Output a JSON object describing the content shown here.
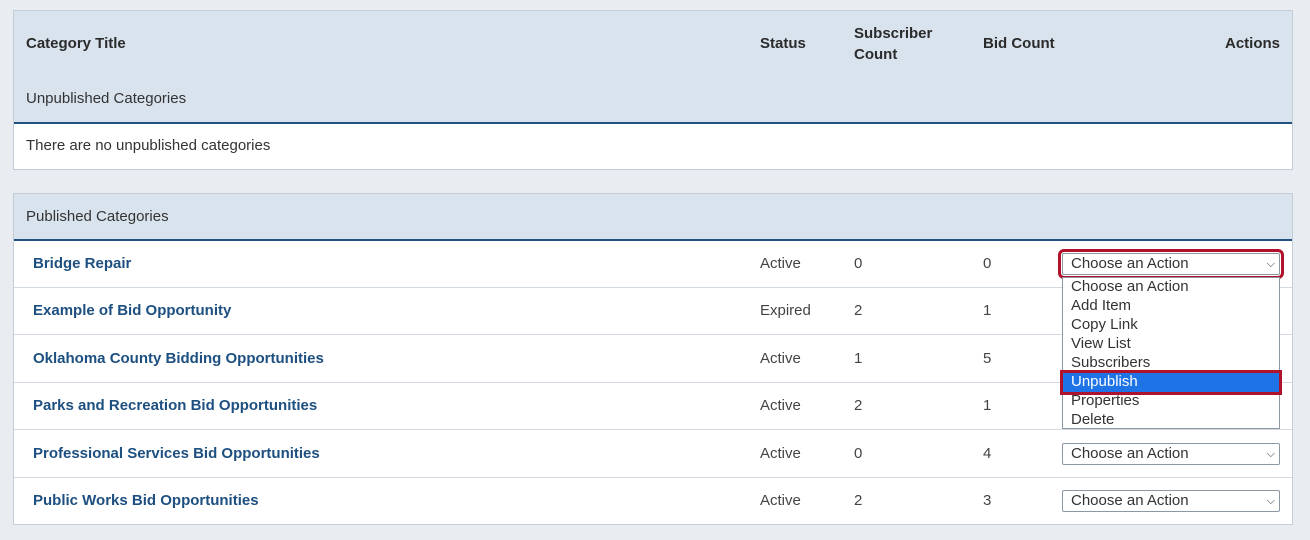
{
  "header": {
    "category_title": "Category Title",
    "status": "Status",
    "subscriber_count_line1": "Subscriber",
    "subscriber_count_line2": "Count",
    "bid_count": "Bid Count",
    "actions": "Actions"
  },
  "unpublished": {
    "label": "Unpublished Categories",
    "empty_message": "There are no unpublished categories"
  },
  "published": {
    "label": "Published Categories",
    "rows": [
      {
        "title": "Bridge Repair",
        "status": "Active",
        "subscribers": "0",
        "bids": "0",
        "action": "Choose an Action"
      },
      {
        "title": "Example of Bid Opportunity",
        "status": "Expired",
        "subscribers": "2",
        "bids": "1",
        "action": "Choose an Action"
      },
      {
        "title": "Oklahoma County Bidding Opportunities",
        "status": "Active",
        "subscribers": "1",
        "bids": "5",
        "action": "Choose an Action"
      },
      {
        "title": "Parks and Recreation Bid Opportunities",
        "status": "Active",
        "subscribers": "2",
        "bids": "1",
        "action": "Choose an Action"
      },
      {
        "title": "Professional Services Bid Opportunities",
        "status": "Active",
        "subscribers": "0",
        "bids": "4",
        "action": "Choose an Action"
      },
      {
        "title": "Public Works Bid Opportunities",
        "status": "Active",
        "subscribers": "2",
        "bids": "3",
        "action": "Choose an Action"
      }
    ]
  },
  "dropdown": {
    "options": [
      "Choose an Action",
      "Add Item",
      "Copy Link",
      "View List",
      "Subscribers",
      "Unpublish",
      "Properties",
      "Delete"
    ],
    "highlighted": "Unpublish"
  },
  "colors": {
    "header_bg": "#d9e3ee",
    "link": "#1d4f80",
    "highlight": "#1e74e6",
    "focus_outline": "#b0112b"
  },
  "icons": {
    "select_arrow": "chevron-down-icon"
  }
}
